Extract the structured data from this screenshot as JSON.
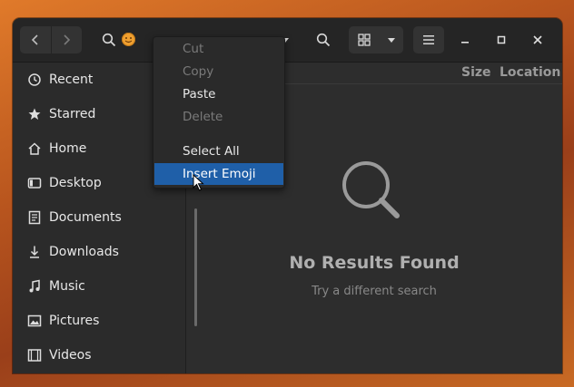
{
  "header": {
    "back_icon": "chevron-left-icon",
    "forward_icon": "chevron-right-icon",
    "search_icon": "search-icon",
    "emoji_icon": "emoji-face-icon",
    "view_icon": "grid-view-icon",
    "menu_icon": "hamburger-icon",
    "minimize_icon": "minimize-icon",
    "maximize_icon": "maximize-icon",
    "close_icon": "close-icon"
  },
  "sidebar": {
    "items": [
      {
        "label": "Recent",
        "icon": "clock-icon"
      },
      {
        "label": "Starred",
        "icon": "star-icon"
      },
      {
        "label": "Home",
        "icon": "home-icon"
      },
      {
        "label": "Desktop",
        "icon": "desktop-icon"
      },
      {
        "label": "Documents",
        "icon": "document-icon"
      },
      {
        "label": "Downloads",
        "icon": "download-icon"
      },
      {
        "label": "Music",
        "icon": "music-icon"
      },
      {
        "label": "Pictures",
        "icon": "picture-icon"
      },
      {
        "label": "Videos",
        "icon": "video-icon"
      }
    ]
  },
  "content": {
    "columns": [
      "Size",
      "Location"
    ],
    "empty_title": "No Results Found",
    "empty_subtitle": "Try a different search"
  },
  "context_menu": {
    "items": [
      {
        "label": "Cut",
        "state": "disabled"
      },
      {
        "label": "Copy",
        "state": "disabled"
      },
      {
        "label": "Paste",
        "state": "enabled"
      },
      {
        "label": "Delete",
        "state": "disabled"
      },
      {
        "label": "Select All",
        "state": "enabled"
      },
      {
        "label": "Insert Emoji",
        "state": "highlighted"
      }
    ]
  },
  "colors": {
    "highlight": "#1f5fa8",
    "window_bg": "#2d2d2d",
    "emoji": "#f0a030"
  }
}
